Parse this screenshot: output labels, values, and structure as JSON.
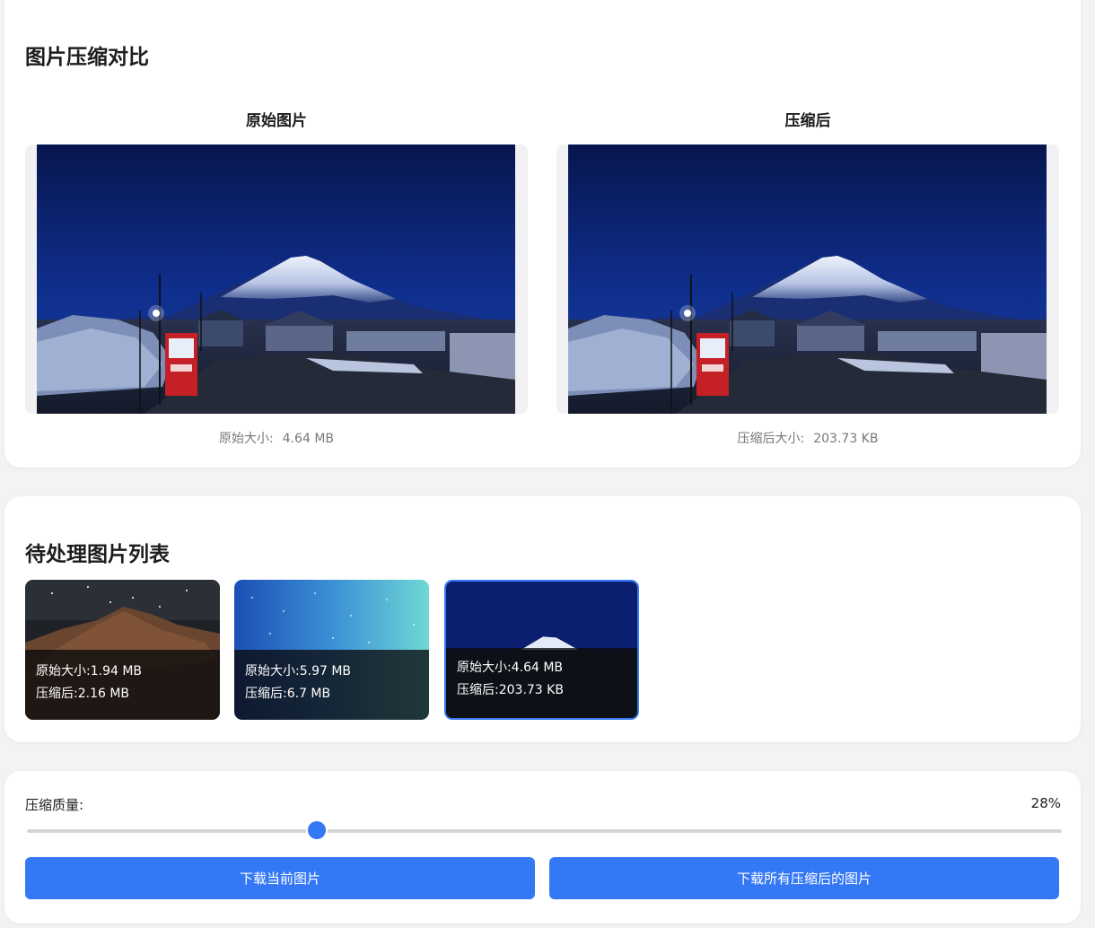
{
  "compare": {
    "title": "图片压缩对比",
    "original": {
      "heading": "原始图片",
      "size_label": "原始大小:",
      "size_value": "4.64 MB"
    },
    "compressed": {
      "heading": "压缩后",
      "size_label": "压缩后大小:",
      "size_value": "203.73 KB"
    }
  },
  "list": {
    "title": "待处理图片列表",
    "items": [
      {
        "orig_label": "原始大小:",
        "orig_value": "1.94 MB",
        "comp_label": "压缩后:",
        "comp_value": "2.16 MB",
        "selected": false
      },
      {
        "orig_label": "原始大小:",
        "orig_value": "5.97 MB",
        "comp_label": "压缩后:",
        "comp_value": "6.7 MB",
        "selected": false
      },
      {
        "orig_label": "原始大小:",
        "orig_value": "4.64 MB",
        "comp_label": "压缩后:",
        "comp_value": "203.73 KB",
        "selected": true
      }
    ]
  },
  "controls": {
    "quality_label": "压缩质量:",
    "quality_value": "28%",
    "quality_fraction": 0.28,
    "download_current": "下载当前图片",
    "download_all": "下载所有压缩后的图片"
  },
  "colors": {
    "accent": "#3478f6",
    "page_bg": "#f3f3f5",
    "card_bg": "#ffffff"
  }
}
